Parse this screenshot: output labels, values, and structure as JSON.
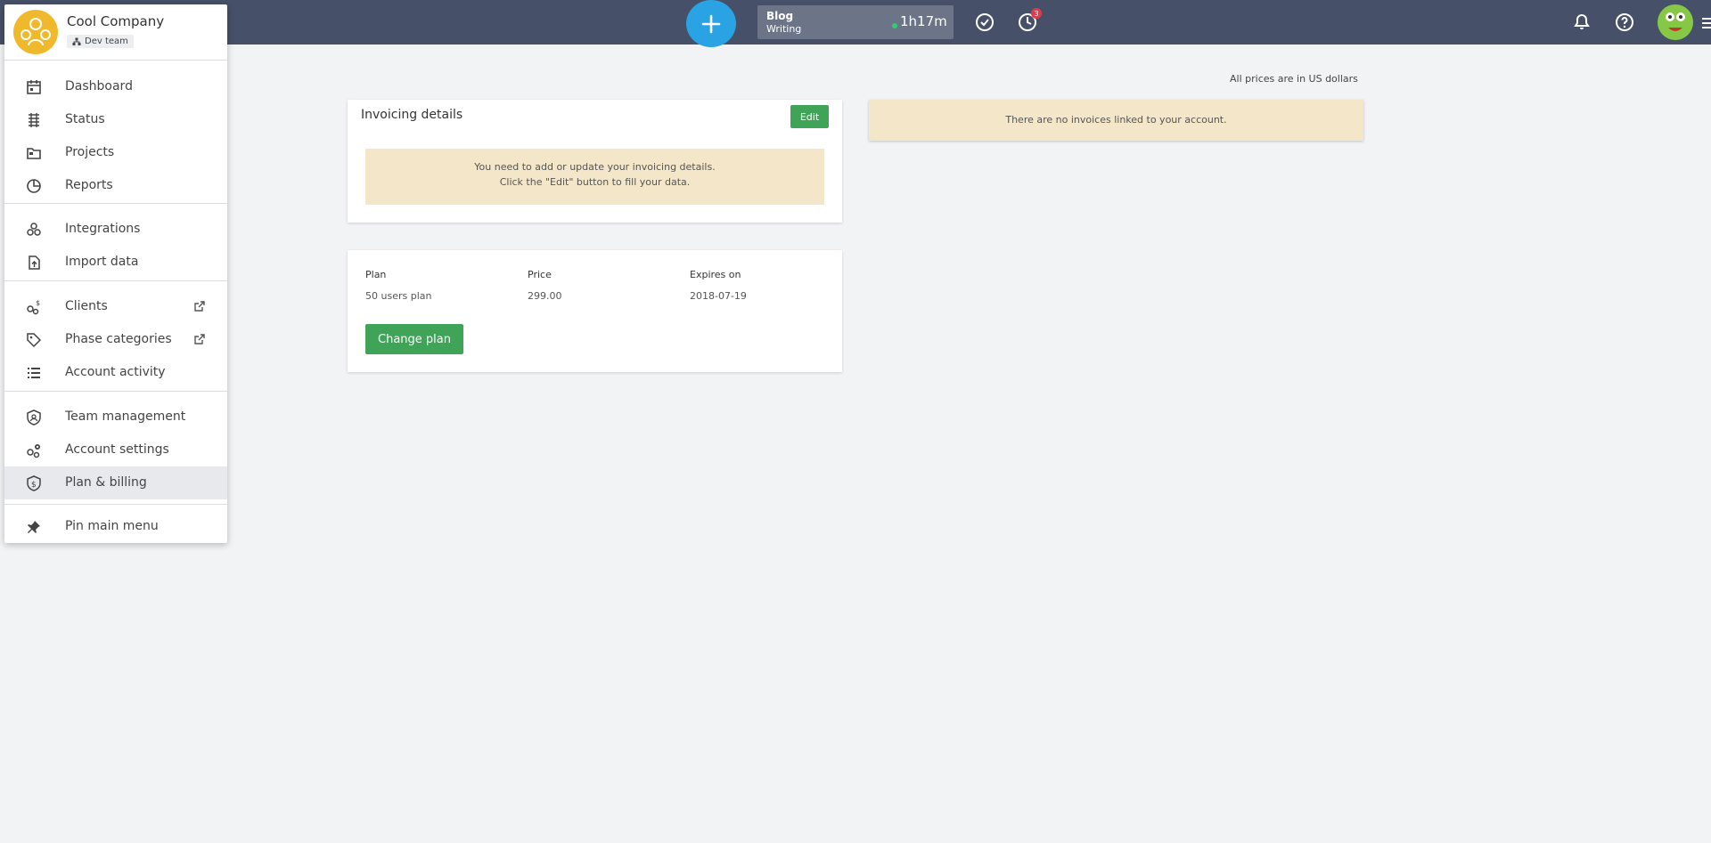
{
  "topbar": {
    "timer": {
      "title": "Blog",
      "subtitle": "Writing",
      "time": "1h17m"
    },
    "clock_badge": "3"
  },
  "sidebar": {
    "company_name": "Cool Company",
    "team": "Dev team",
    "groups": [
      [
        {
          "label": "Dashboard",
          "icon": "calendar-icon"
        },
        {
          "label": "Status",
          "icon": "status-icon"
        },
        {
          "label": "Projects",
          "icon": "folder-icon"
        },
        {
          "label": "Reports",
          "icon": "pie-chart-icon"
        }
      ],
      [
        {
          "label": "Integrations",
          "icon": "integrations-icon"
        },
        {
          "label": "Import data",
          "icon": "import-icon"
        }
      ],
      [
        {
          "label": "Clients",
          "icon": "clients-icon",
          "external": true
        },
        {
          "label": "Phase categories",
          "icon": "tag-icon",
          "external": true
        },
        {
          "label": "Account activity",
          "icon": "list-icon"
        }
      ],
      [
        {
          "label": "Team management",
          "icon": "shield-icon"
        },
        {
          "label": "Account settings",
          "icon": "settings-icon"
        },
        {
          "label": "Plan & billing",
          "icon": "billing-icon",
          "active": true
        }
      ],
      [
        {
          "label": "Pin main menu",
          "icon": "pin-icon"
        }
      ]
    ]
  },
  "content": {
    "price_note": "All prices are in US dollars",
    "invoicing": {
      "title": "Invoicing details",
      "edit_label": "Edit",
      "warning_line1": "You need to add or update your invoicing details.",
      "warning_line2": "Click the \"Edit\" button to fill your data."
    },
    "no_invoices": "There are no invoices linked to your account.",
    "plan": {
      "headers": [
        "Plan",
        "Price",
        "Expires on"
      ],
      "values": [
        "50 users plan",
        "299.00",
        "2018-07-19"
      ],
      "change_label": "Change plan"
    }
  },
  "colors": {
    "topbar": "#465068",
    "accent_blue": "#29a3e3",
    "green": "#3fa457",
    "warning_bg": "#f4e7c9"
  }
}
